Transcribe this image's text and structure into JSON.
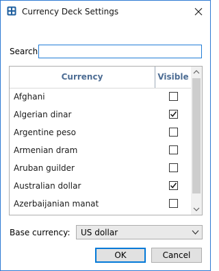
{
  "window": {
    "title": "Currency Deck Settings",
    "app_icon": "calculator-grid-icon",
    "close_icon": "close-icon"
  },
  "search": {
    "label": "Search",
    "value": "",
    "placeholder": ""
  },
  "grid": {
    "columns": [
      "Currency",
      "Visible"
    ],
    "rows": [
      {
        "name": "Afghani",
        "visible": false
      },
      {
        "name": "Algerian dinar",
        "visible": true
      },
      {
        "name": "Argentine peso",
        "visible": false
      },
      {
        "name": "Armenian dram",
        "visible": false
      },
      {
        "name": "Aruban guilder",
        "visible": false
      },
      {
        "name": "Australian dollar",
        "visible": true
      },
      {
        "name": "Azerbaijanian manat",
        "visible": false
      }
    ]
  },
  "base_currency": {
    "label": "Base currency:",
    "value": "US dollar"
  },
  "buttons": {
    "ok": "OK",
    "cancel": "Cancel"
  },
  "colors": {
    "accent": "#0078d7",
    "header_text": "#4d6d94",
    "window_border": "#2b78d3"
  }
}
